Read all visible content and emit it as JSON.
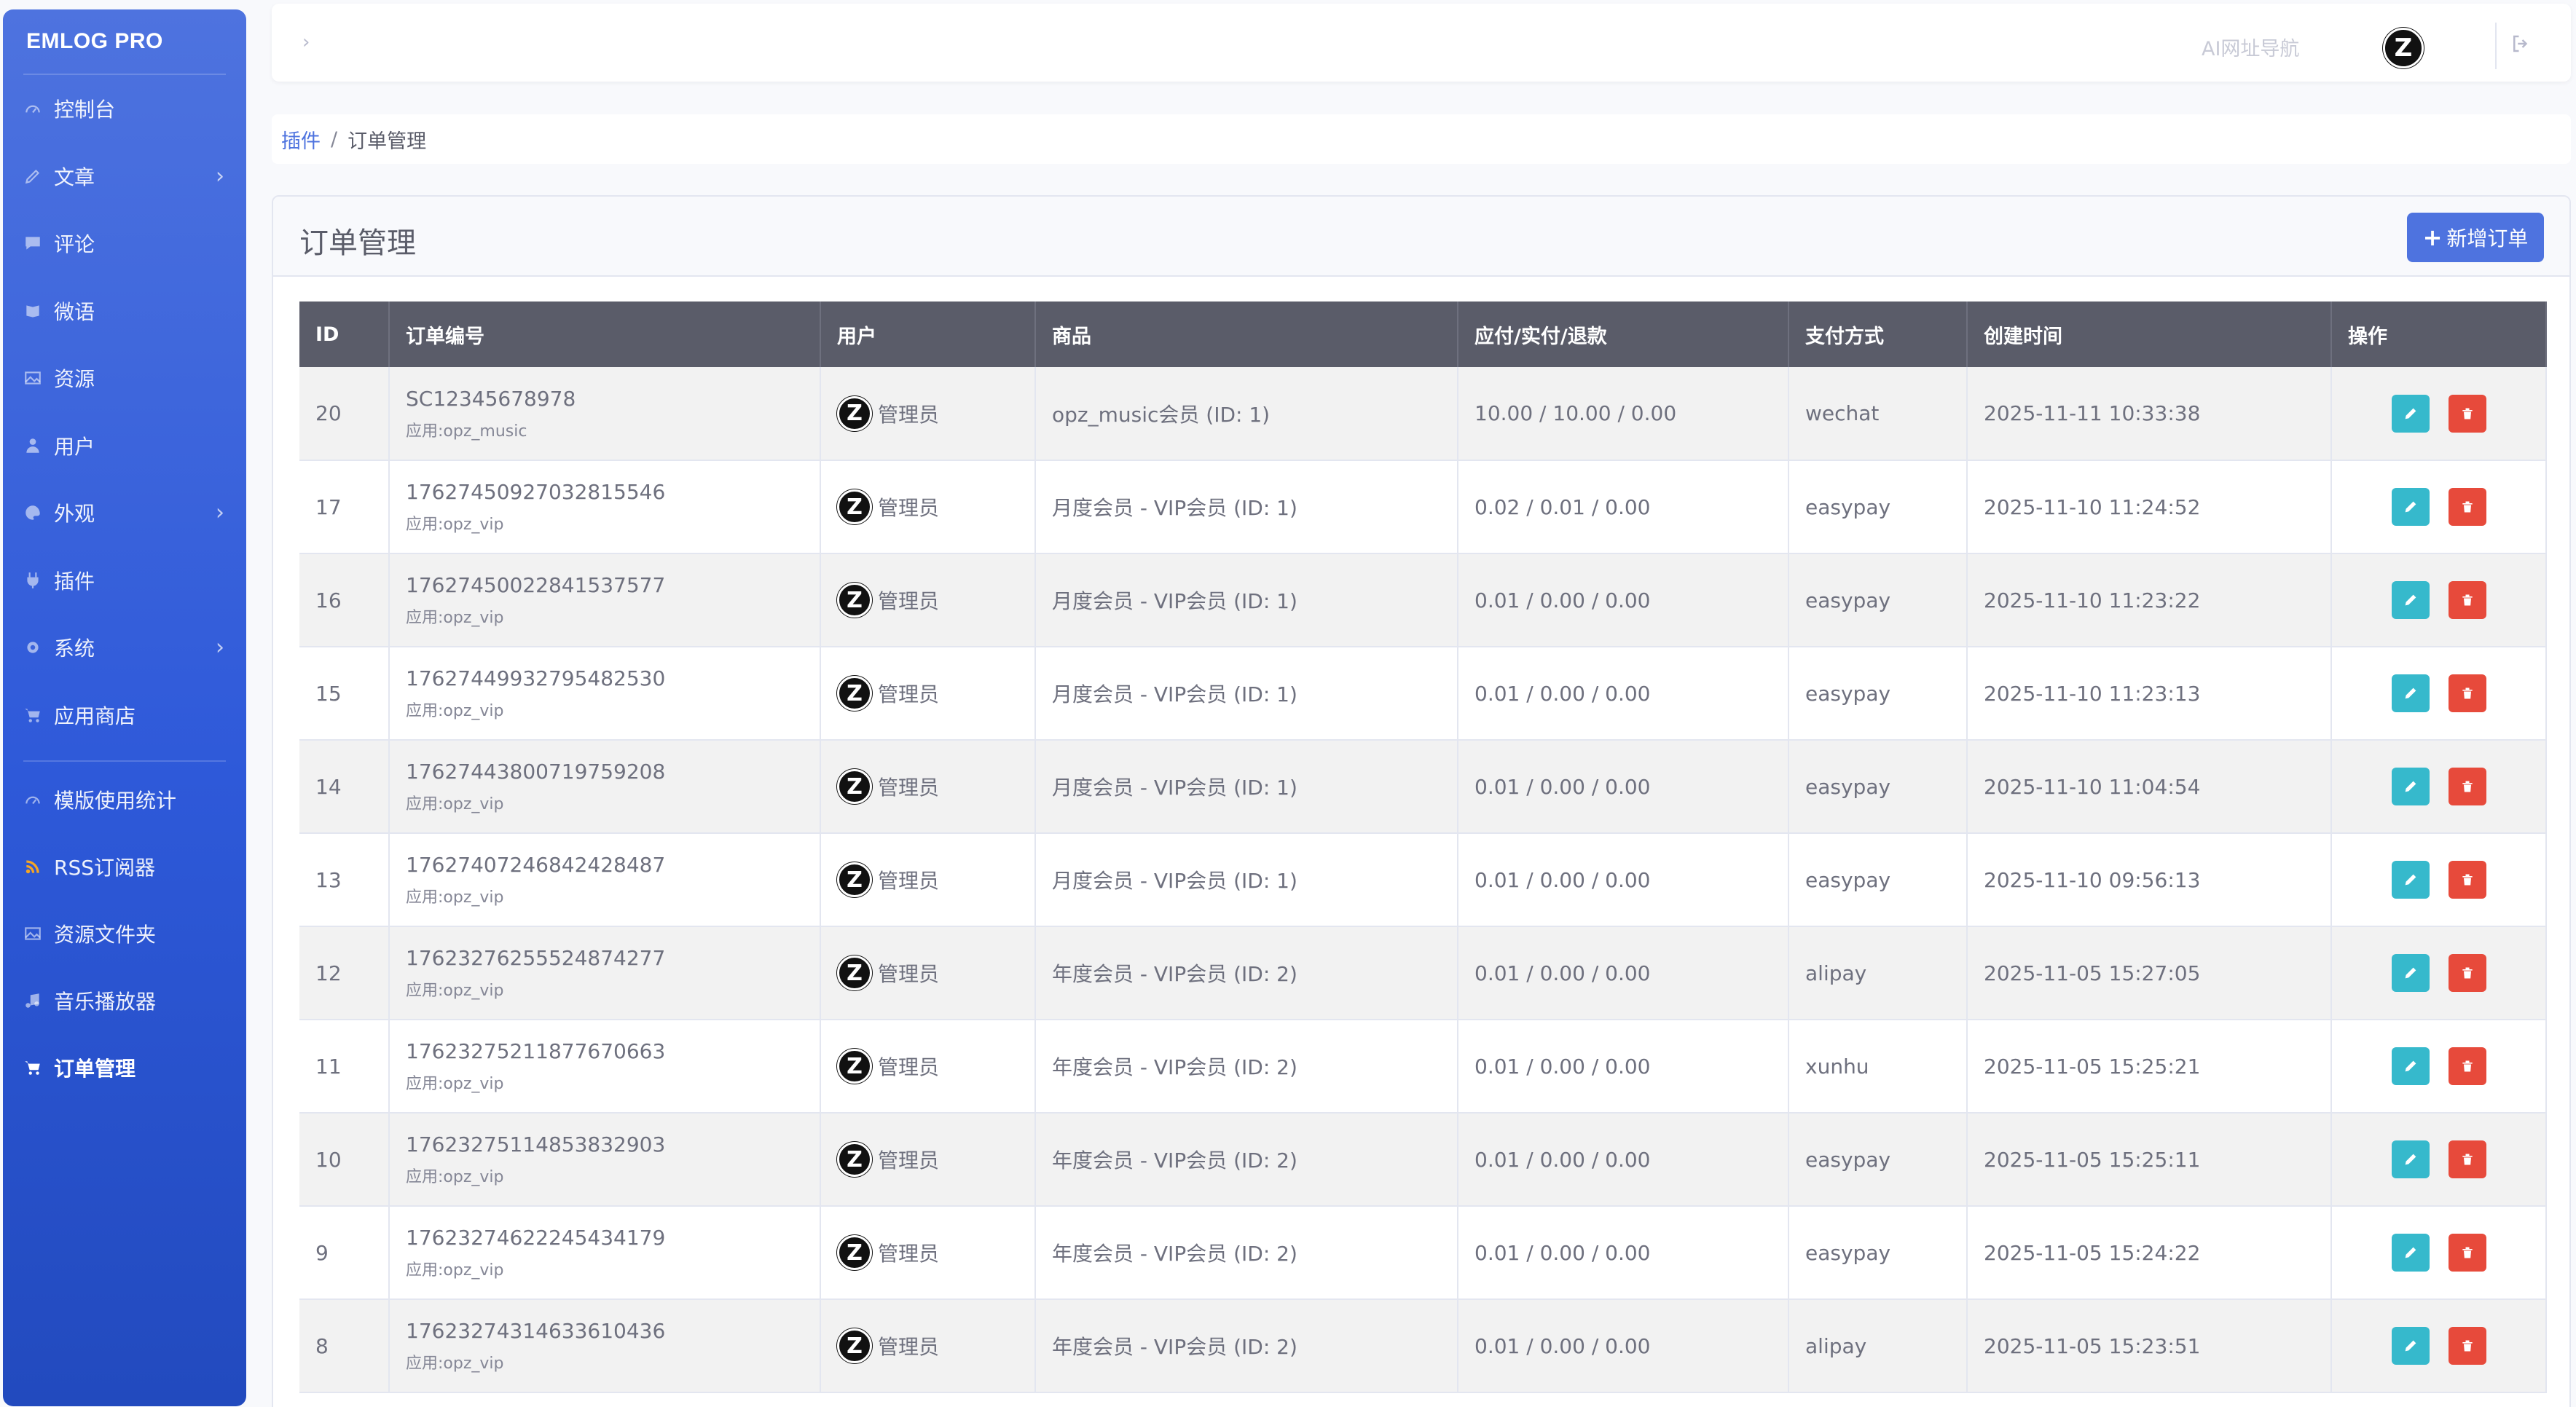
{
  "sidebar": {
    "brand": "EMLOG PRO",
    "items": [
      {
        "label": "控制台",
        "icon": "dashboard-icon",
        "has_children": false
      },
      {
        "label": "文章",
        "icon": "pencil-icon",
        "has_children": true
      },
      {
        "label": "评论",
        "icon": "comment-icon",
        "has_children": false
      },
      {
        "label": "微语",
        "icon": "note-icon",
        "has_children": false
      },
      {
        "label": "资源",
        "icon": "image-icon",
        "has_children": false
      },
      {
        "label": "用户",
        "icon": "user-icon",
        "has_children": false
      },
      {
        "label": "外观",
        "icon": "palette-icon",
        "has_children": true
      },
      {
        "label": "插件",
        "icon": "plug-icon",
        "has_children": false
      },
      {
        "label": "系统",
        "icon": "gear-icon",
        "has_children": true
      },
      {
        "label": "应用商店",
        "icon": "cart-icon",
        "has_children": false
      }
    ],
    "plugin_items": [
      {
        "label": "模版使用统计",
        "icon": "dashboard-icon"
      },
      {
        "label": "RSS订阅器",
        "icon": "rss-icon"
      },
      {
        "label": "资源文件夹",
        "icon": "image-icon"
      },
      {
        "label": "音乐播放器",
        "icon": "music-icon"
      },
      {
        "label": "订单管理",
        "icon": "cart-icon",
        "active": true
      }
    ]
  },
  "topbar": {
    "toggle_glyph": "›",
    "nav_link": "AI网址导航",
    "avatar_letter": "Z"
  },
  "breadcrumb": {
    "parent": "插件",
    "separator": "/",
    "current": "订单管理"
  },
  "card": {
    "title": "订单管理",
    "add_button": "新增订单",
    "add_button_icon": "plus-icon"
  },
  "table": {
    "headers": [
      "ID",
      "订单编号",
      "用户",
      "商品",
      "应付/实付/退款",
      "支付方式",
      "创建时间",
      "操作"
    ],
    "rows": [
      {
        "id": "20",
        "order_no": "SC12345678978",
        "app": "应用:opz_music",
        "user": "管理员",
        "product": "opz_music会员 (ID: 1)",
        "amounts": "10.00 / 10.00 / 0.00",
        "payment": "wechat",
        "created": "2025-11-11 10:33:38"
      },
      {
        "id": "17",
        "order_no": "17627450927032815546",
        "app": "应用:opz_vip",
        "user": "管理员",
        "product": "月度会员 - VIP会员 (ID: 1)",
        "amounts": "0.02 / 0.01 / 0.00",
        "payment": "easypay",
        "created": "2025-11-10 11:24:52"
      },
      {
        "id": "16",
        "order_no": "17627450022841537577",
        "app": "应用:opz_vip",
        "user": "管理员",
        "product": "月度会员 - VIP会员 (ID: 1)",
        "amounts": "0.01 / 0.00 / 0.00",
        "payment": "easypay",
        "created": "2025-11-10 11:23:22"
      },
      {
        "id": "15",
        "order_no": "17627449932795482530",
        "app": "应用:opz_vip",
        "user": "管理员",
        "product": "月度会员 - VIP会员 (ID: 1)",
        "amounts": "0.01 / 0.00 / 0.00",
        "payment": "easypay",
        "created": "2025-11-10 11:23:13"
      },
      {
        "id": "14",
        "order_no": "17627443800719759208",
        "app": "应用:opz_vip",
        "user": "管理员",
        "product": "月度会员 - VIP会员 (ID: 1)",
        "amounts": "0.01 / 0.00 / 0.00",
        "payment": "easypay",
        "created": "2025-11-10 11:04:54"
      },
      {
        "id": "13",
        "order_no": "17627407246842428487",
        "app": "应用:opz_vip",
        "user": "管理员",
        "product": "月度会员 - VIP会员 (ID: 1)",
        "amounts": "0.01 / 0.00 / 0.00",
        "payment": "easypay",
        "created": "2025-11-10 09:56:13"
      },
      {
        "id": "12",
        "order_no": "17623276255524874277",
        "app": "应用:opz_vip",
        "user": "管理员",
        "product": "年度会员 - VIP会员 (ID: 2)",
        "amounts": "0.01 / 0.00 / 0.00",
        "payment": "alipay",
        "created": "2025-11-05 15:27:05"
      },
      {
        "id": "11",
        "order_no": "17623275211877670663",
        "app": "应用:opz_vip",
        "user": "管理员",
        "product": "年度会员 - VIP会员 (ID: 2)",
        "amounts": "0.01 / 0.00 / 0.00",
        "payment": "xunhu",
        "created": "2025-11-05 15:25:21"
      },
      {
        "id": "10",
        "order_no": "17623275114853832903",
        "app": "应用:opz_vip",
        "user": "管理员",
        "product": "年度会员 - VIP会员 (ID: 2)",
        "amounts": "0.01 / 0.00 / 0.00",
        "payment": "easypay",
        "created": "2025-11-05 15:25:11"
      },
      {
        "id": "9",
        "order_no": "17623274622245434179",
        "app": "应用:opz_vip",
        "user": "管理员",
        "product": "年度会员 - VIP会员 (ID: 2)",
        "amounts": "0.01 / 0.00 / 0.00",
        "payment": "easypay",
        "created": "2025-11-05 15:24:22"
      },
      {
        "id": "8",
        "order_no": "17623274314633610436",
        "app": "应用:opz_vip",
        "user": "管理员",
        "product": "年度会员 - VIP会员 (ID: 2)",
        "amounts": "0.01 / 0.00 / 0.00",
        "payment": "alipay",
        "created": "2025-11-05 15:23:51"
      }
    ]
  },
  "colors": {
    "sidebar_top": "#4e73df",
    "sidebar_bottom": "#224abe",
    "primary": "#4e73df",
    "header_dark": "#5a5c69",
    "edit": "#36b9cc",
    "delete": "#e74a3b"
  }
}
